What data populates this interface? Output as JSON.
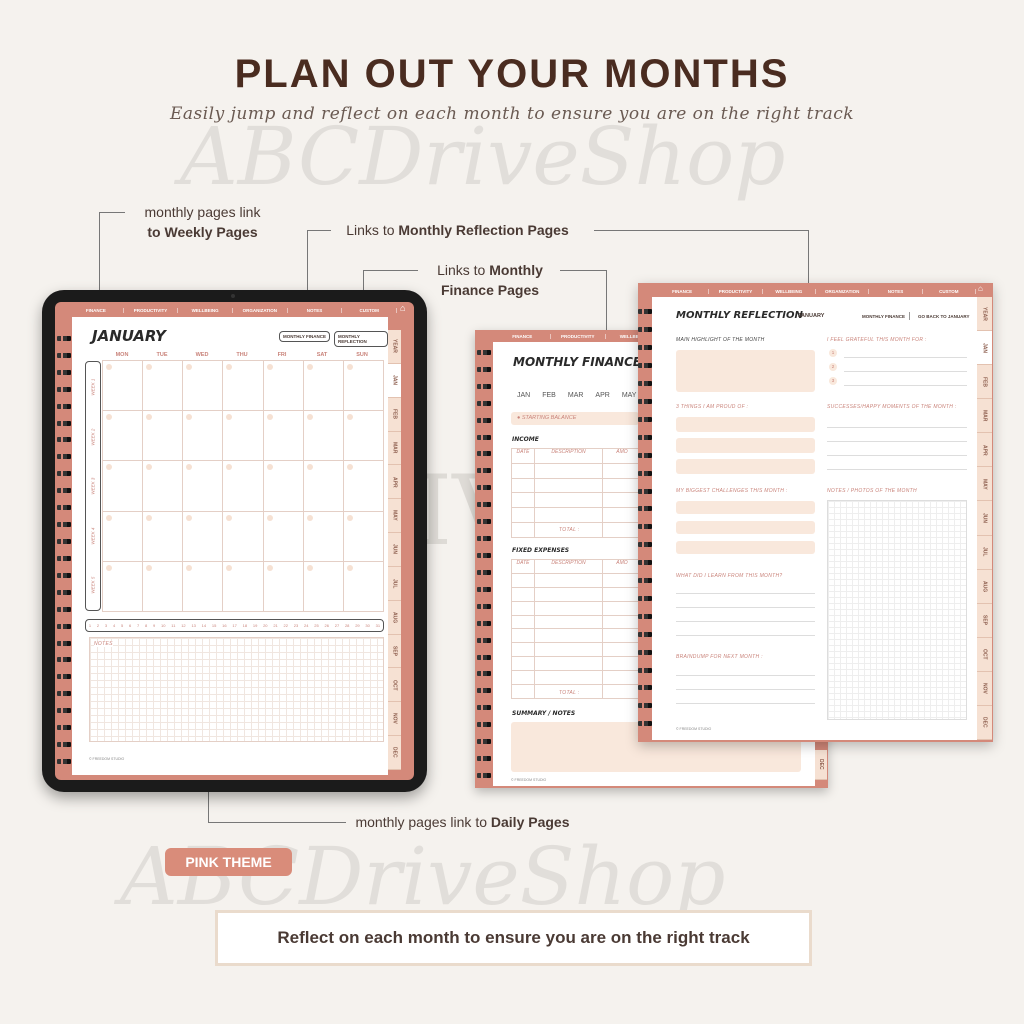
{
  "header": {
    "title": "PLAN OUT YOUR MONTHS",
    "subtitle": "Easily jump and reflect on each month to ensure you are on the right track"
  },
  "callouts": {
    "weekly": {
      "pre": "monthly pages link",
      "link": "to Weekly Pages"
    },
    "reflection": {
      "pre": "Links to ",
      "link": "Monthly Reflection Pages"
    },
    "finance": {
      "pre": "Links to ",
      "link1": "Monthly",
      "link2": "Finance Pages"
    },
    "daily": {
      "pre": "monthly pages link to ",
      "link": "Daily Pages"
    }
  },
  "nav": [
    "FINANCE",
    "PRODUCTIVITY",
    "WELLBEING",
    "ORGANIZATION",
    "NOTES",
    "CUSTOM"
  ],
  "month_tabs": [
    "YEAR",
    "JAN",
    "FEB",
    "MAR",
    "APR",
    "MAY",
    "JUN",
    "JUL",
    "AUG",
    "SEP",
    "OCT",
    "NOV",
    "DEC"
  ],
  "calendar": {
    "month": "JANUARY",
    "btn_finance": "MONTHLY FINANCE",
    "btn_reflection": "MONTHLY REFLECTION",
    "days": [
      "MON",
      "TUE",
      "WED",
      "THU",
      "FRI",
      "SAT",
      "SUN"
    ],
    "weeks": [
      "WEEK 1",
      "WEEK 2",
      "WEEK 3",
      "WEEK 4",
      "WEEK 5"
    ],
    "dates": [
      "1",
      "2",
      "3",
      "4",
      "5",
      "6",
      "7",
      "8",
      "9",
      "10",
      "11",
      "12",
      "13",
      "14",
      "15",
      "16",
      "17",
      "18",
      "19",
      "20",
      "21",
      "22",
      "23",
      "24",
      "25",
      "26",
      "27",
      "28",
      "29",
      "30",
      "31"
    ],
    "notes": "NOTES",
    "footer": "© FREEDOM STUDIO"
  },
  "finance": {
    "title": "MONTHLY FINANCE",
    "months": [
      "JAN",
      "FEB",
      "MAR",
      "APR",
      "MAY"
    ],
    "starting_balance": "STARTING BALANCE",
    "income": "INCOME",
    "fixed": "FIXED EXPENSES",
    "cols": [
      "DATE",
      "DESCRIPTION",
      "AMO"
    ],
    "total": "TOTAL :",
    "summary": "SUMMARY / NOTES",
    "footer": "© FREEDOM STUDIO",
    "tab": "DEC"
  },
  "reflection": {
    "title": "MONTHLY REFLECTION",
    "month": "JANUARY",
    "link_finance": "MONTHLY FINANCE",
    "link_back": "GO BACK TO JANUARY",
    "highlight": "MAIN HIGHLIGHT OF THE MONTH",
    "grateful": "I FEEL GRATEFUL THIS MONTH FOR :",
    "grateful_nums": [
      "1",
      "2",
      "3"
    ],
    "proud": "3 THINGS I AM PROUD OF :",
    "successes": "SUCCESSES/HAPPY MOMENTS OF THE MONTH :",
    "challenges": "MY BIGGEST CHALLENGES THIS MONTH :",
    "photos": "NOTES / PHOTOS OF THE MONTH",
    "learn": "WHAT DID I LEARN FROM THIS MONTH?",
    "brain": "BRAINDUMP FOR NEXT MONTH :",
    "footer": "© FREEDOM STUDIO"
  },
  "badge": "PINK THEME",
  "bottom": "Reflect on each month to ensure you are on the right track",
  "watermark": "ABCDriveShop",
  "watermark_caps": "ABCDRIVESHOP",
  "colors": {
    "accent": "#d4897a",
    "beige": "#f9e8dc",
    "title": "#4a2c20"
  }
}
